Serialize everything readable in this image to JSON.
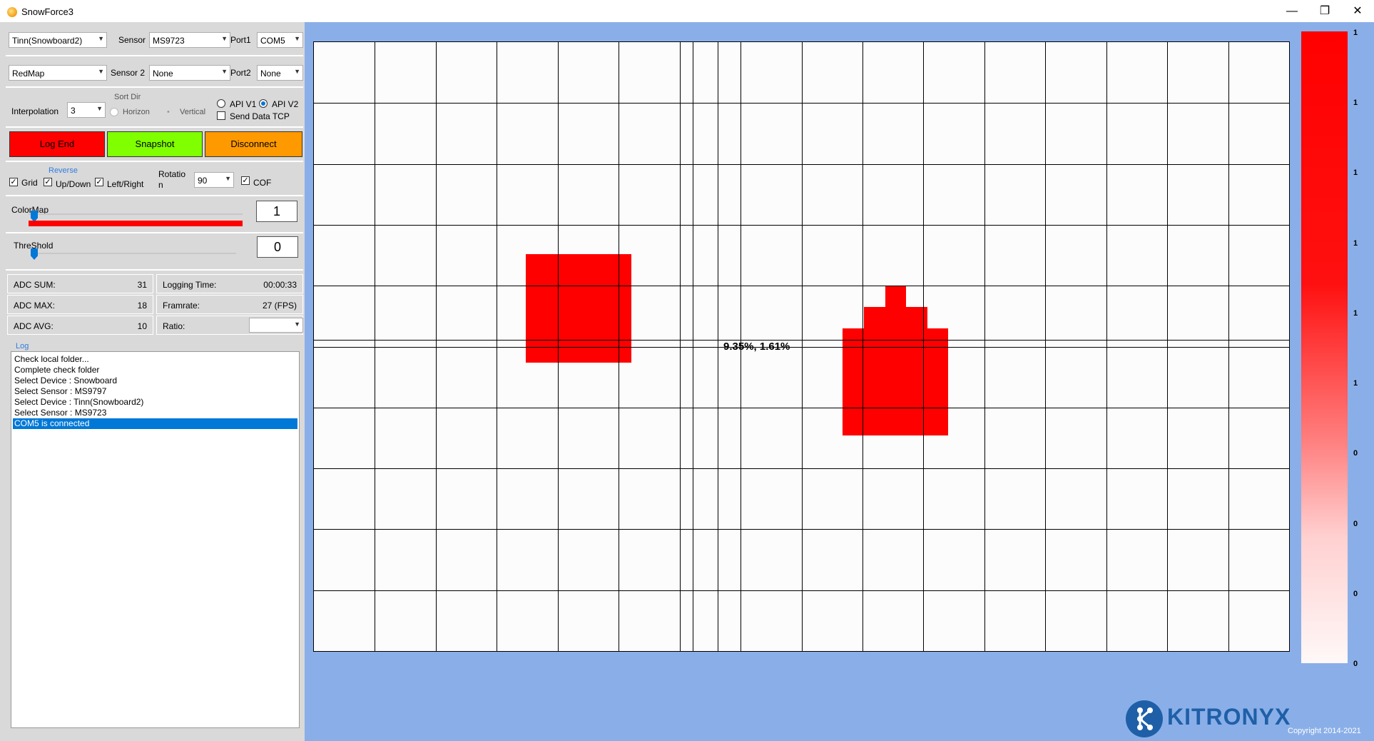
{
  "window": {
    "title": "SnowForce3",
    "minimize_icon": "minimize-icon",
    "restore_icon": "restore-icon",
    "close_icon": "close-icon"
  },
  "config": {
    "device": "Tinn(Snowboard2)",
    "sensor_label": "Sensor",
    "sensor": "MS9723",
    "port1_label": "Port1",
    "port1": "COM5",
    "colormap": "RedMap",
    "sensor2_label": "Sensor 2",
    "sensor2": "None",
    "port2_label": "Port2",
    "port2": "None"
  },
  "interp": {
    "label": "Interpolation",
    "value": "3",
    "sortdir_label": "Sort Dir",
    "horizon": "Horizon",
    "vertical": "Vertical",
    "api_v1": "API V1",
    "api_v2": "API V2",
    "api_selected": "API V2",
    "send_tcp": "Send Data TCP"
  },
  "actions": {
    "log_end": "Log End",
    "snapshot": "Snapshot",
    "disconnect": "Disconnect",
    "log_end_color": "#ff0000",
    "snapshot_color": "#80ff00",
    "disconnect_color": "#ff9900"
  },
  "view": {
    "grid": "Grid",
    "reverse_label": "Reverse",
    "updown": "Up/Down",
    "leftright": "Left/Right",
    "rotation_label_1": "Rotatio",
    "rotation_label_2": "n",
    "rotation": "90",
    "cof": "COF"
  },
  "colormap_slider": {
    "label": "ColorMap",
    "value": "1",
    "fraction": 0.02
  },
  "threshold_slider": {
    "label": "ThreShold",
    "value": "0",
    "fraction": 0.0
  },
  "stats": {
    "adc_sum_label": "ADC SUM:",
    "adc_sum": "31",
    "adc_max_label": "ADC MAX:",
    "adc_max": "18",
    "adc_avg_label": "ADC AVG:",
    "adc_avg": "10",
    "logging_time_label": "Logging Time:",
    "logging_time": "00:00:33",
    "framerate_label": "Framrate:",
    "framerate": "27 (FPS)",
    "ratio_label": "Ratio:",
    "ratio": ""
  },
  "log": {
    "title": "Log",
    "items": [
      "Check local folder...",
      "Complete check folder",
      "Select Device : Snowboard",
      "Select Sensor : MS9797",
      "Select Device : Tinn(Snowboard2)",
      "Select Sensor : MS9723",
      "COM5 is connected"
    ],
    "selected_index": 6
  },
  "heatmap": {
    "cof_text": "9.35%,  1.61%",
    "active_color": "#ff0000"
  },
  "colorbar": {
    "ticks": [
      "1",
      "1",
      "1",
      "1",
      "1",
      "1",
      "0",
      "0",
      "0",
      "0"
    ]
  },
  "brand": {
    "logo": "KITRONYX",
    "copyright": "Copyright 2014-2021"
  }
}
